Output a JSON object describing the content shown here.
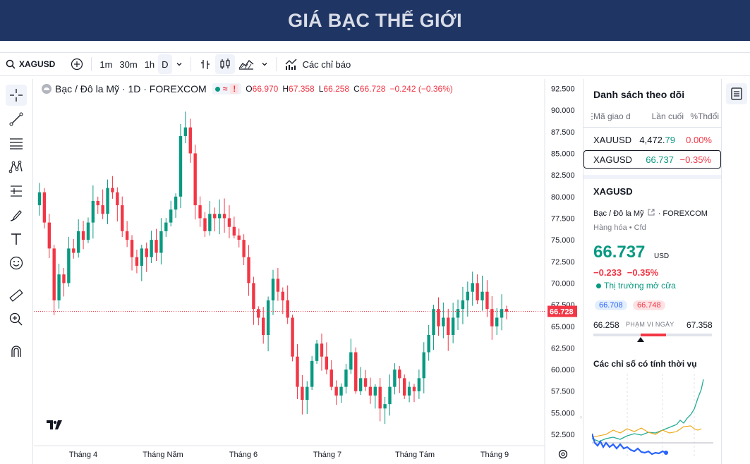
{
  "banner": {
    "title": "GIÁ BẠC THẾ GIỚI"
  },
  "toolbar": {
    "symbol": "XAGUSD",
    "intervals": [
      "1m",
      "30m",
      "1h",
      "D"
    ],
    "active_interval": "D",
    "indicators_label": "Các chỉ báo"
  },
  "legend": {
    "name": "Bạc / Đô la Mỹ · 1D · FOREXCOM",
    "o_label": "O",
    "o": "66.970",
    "h_label": "H",
    "h": "67.358",
    "l_label": "L",
    "l": "66.258",
    "c_label": "C",
    "c": "66.728",
    "change": "−0.242 (−0.36%)"
  },
  "price_axis": [
    "92.500",
    "90.000",
    "87.500",
    "85.000",
    "82.500",
    "80.000",
    "77.500",
    "75.000",
    "72.500",
    "70.000",
    "67.500",
    "65.000",
    "62.500",
    "60.000",
    "57.500",
    "55.000",
    "52.500"
  ],
  "last_price_label": "66.728",
  "time_axis": [
    "Tháng 4",
    "Tháng Năm",
    "Tháng 6",
    "Tháng 7",
    "Tháng Tám",
    "Tháng 9"
  ],
  "colors": {
    "up": "#089981",
    "down": "#f23645",
    "banner": "#1f3564"
  },
  "watchlist": {
    "title": "Danh sách theo dõi",
    "col_symbol": "Mã giao d",
    "col_last": "Lần cuối",
    "col_change": "%Thđổi",
    "rows": [
      {
        "symbol": "XAUUSD",
        "last_main": "4,472.",
        "last_tail": "79",
        "change": "0.00%"
      },
      {
        "symbol": "XAGUSD",
        "last_main": "66.737",
        "last_tail": "",
        "change": "−0.35%"
      }
    ]
  },
  "details": {
    "symbol": "XAGUSD",
    "name": "Bạc / Đô la Mỹ",
    "exchange": "FOREXCOM",
    "type": "Hàng hóa • Cfd",
    "price": "66.737",
    "currency": "USD",
    "change": "−0.233",
    "change_pct": "−0.35%",
    "market_status": "Thị trường mở cửa",
    "bid": "66.708",
    "ask": "66.748",
    "day_low": "66.258",
    "day_high": "67.358",
    "range_label": "PHẠM VI NGÀY",
    "day_range_position": 0.4,
    "seasonal_title": "Các chỉ số có tính thời vụ"
  },
  "chart_data": {
    "type": "candlestick",
    "title": "Bạc / Đô la Mỹ · 1D · FOREXCOM",
    "ylim": [
      51.2,
      93.6
    ],
    "x_ticks": [
      "Tháng 4",
      "Tháng Năm",
      "Tháng 6",
      "Tháng 7",
      "Tháng Tám",
      "Tháng 9"
    ],
    "close_path": [
      80.5,
      77,
      74,
      68,
      71,
      70,
      74,
      73.5,
      76,
      75,
      77,
      79.5,
      79,
      78,
      81,
      80.5,
      79,
      76,
      75,
      73,
      72,
      74,
      73,
      75,
      73.5,
      76,
      77,
      78.5,
      80,
      87,
      88,
      85,
      79,
      77.5,
      76,
      78,
      77.5,
      78,
      77.5,
      76.5,
      75.5,
      75,
      73,
      70,
      67,
      66,
      64,
      68,
      70.5,
      69,
      68,
      66,
      61.5,
      58,
      56.5,
      58,
      61,
      63,
      61.5,
      60,
      58,
      57,
      58,
      60,
      62,
      57.5,
      59,
      58,
      57,
      58,
      55.5,
      56,
      58,
      60,
      59,
      57,
      58,
      57.5,
      59,
      62,
      64,
      67,
      65,
      66,
      64,
      66,
      67,
      68,
      69,
      70,
      68,
      69,
      67,
      65,
      66,
      67,
      66.7
    ]
  }
}
